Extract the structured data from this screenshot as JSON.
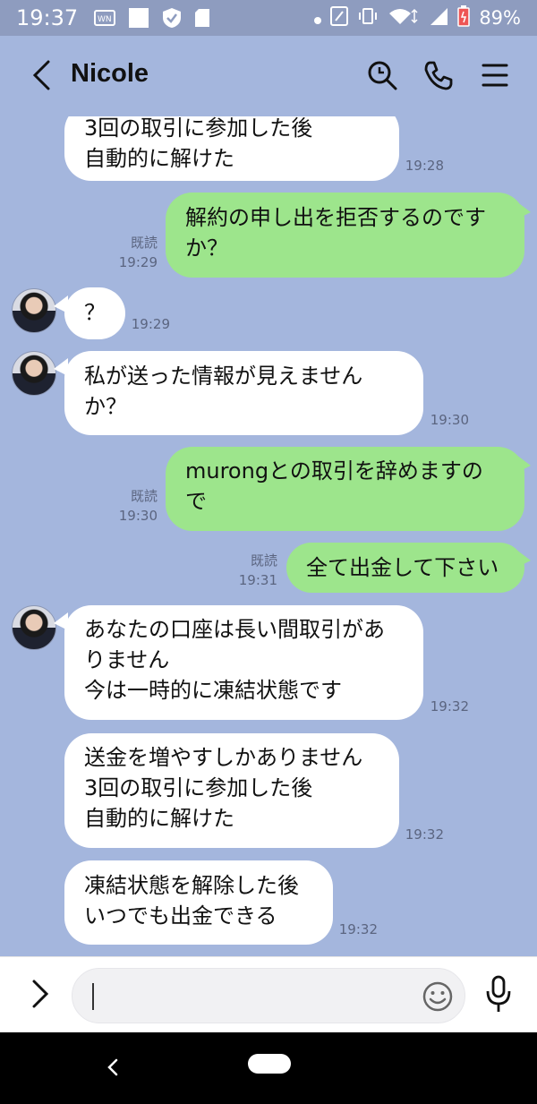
{
  "status_bar": {
    "time": "19:37",
    "battery": "89%"
  },
  "header": {
    "title": "Nicole"
  },
  "messages": [
    {
      "side": "in",
      "avatar": false,
      "lines": "3回の取引に参加した後\n自動的に解けた",
      "time": "19:28"
    },
    {
      "side": "out",
      "read": "既読",
      "lines": "解約の申し出を拒否するのです\nか？",
      "time": "19:29"
    },
    {
      "side": "in",
      "avatar": true,
      "lines": "？",
      "time": "19:29"
    },
    {
      "side": "in",
      "avatar": true,
      "lines": "私が送った情報が見えません\nか？",
      "time": "19:30"
    },
    {
      "side": "out",
      "read": "既読",
      "lines": "murongとの取引を辞めますの\nで",
      "time": "19:30"
    },
    {
      "side": "out",
      "read": "既読",
      "lines": "全て出金して下さい",
      "time": "19:31"
    },
    {
      "side": "in",
      "avatar": true,
      "lines": "あなたの口座は長い間取引があ\nりません\n今は一時的に凍結状態です",
      "time": "19:32"
    },
    {
      "side": "in",
      "avatar": false,
      "lines": "送金を増やすしかありません\n3回の取引に参加した後\n自動的に解けた",
      "time": "19:32"
    },
    {
      "side": "in",
      "avatar": false,
      "lines": "凍結状態を解除した後\nいつでも出金できる",
      "time": "19:32"
    }
  ],
  "input": {
    "value": "",
    "placeholder": ""
  },
  "colors": {
    "chat_background": "#a4b6dd",
    "outgoing_bubble": "#9de58c",
    "incoming_bubble": "#ffffff"
  }
}
